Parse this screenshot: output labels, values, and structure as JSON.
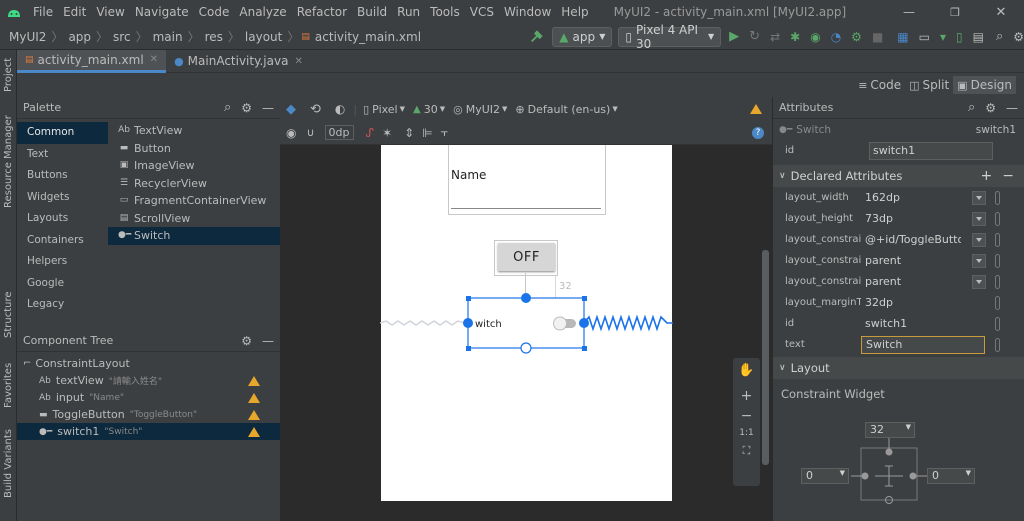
{
  "window": {
    "title": "MyUI2 - activity_main.xml [MyUI2.app]"
  },
  "menu": [
    "File",
    "Edit",
    "View",
    "Navigate",
    "Code",
    "Analyze",
    "Refactor",
    "Build",
    "Run",
    "Tools",
    "VCS",
    "Window",
    "Help"
  ],
  "breadcrumb": [
    "MyUI2",
    "app",
    "src",
    "main",
    "res",
    "layout",
    "activity_main.xml"
  ],
  "toolbar": {
    "run_config": "app",
    "device": "Pixel 4 API 30"
  },
  "side_tools": {
    "project": "Project",
    "resource_manager": "Resource Manager",
    "structure": "Structure",
    "favorites": "Favorites",
    "build_variants": "Build Variants"
  },
  "tabs": [
    {
      "label": "activity_main.xml"
    },
    {
      "label": "MainActivity.java"
    }
  ],
  "view_modes": [
    "Code",
    "Split",
    "Design"
  ],
  "palette": {
    "title": "Palette",
    "categories": [
      "Common",
      "Text",
      "Buttons",
      "Widgets",
      "Layouts",
      "Containers",
      "Helpers",
      "Google",
      "Legacy"
    ],
    "widgets": [
      {
        "icon": "Ab",
        "label": "TextView"
      },
      {
        "icon": "▬",
        "label": "Button"
      },
      {
        "icon": "▣",
        "label": "ImageView"
      },
      {
        "icon": "☰",
        "label": "RecyclerView"
      },
      {
        "icon": "▭",
        "label": "FragmentContainerView"
      },
      {
        "icon": "▤",
        "label": "ScrollView"
      },
      {
        "icon": "●━",
        "label": "Switch"
      }
    ]
  },
  "component_tree": {
    "title": "Component Tree",
    "root": "ConstraintLayout",
    "nodes": [
      {
        "icon": "Ab",
        "name": "textView",
        "desc": "\"請輸入姓名\""
      },
      {
        "icon": "Ab",
        "name": "input",
        "desc": "\"Name\""
      },
      {
        "icon": "▬",
        "name": "ToggleButton",
        "desc": "\"ToggleButton\""
      },
      {
        "icon": "●━",
        "name": "switch1",
        "desc": "\"Switch\""
      }
    ]
  },
  "design_toolbar": {
    "device": "Pixel",
    "api": "30",
    "theme": "MyUI2",
    "locale": "Default (en-us)",
    "margin": "0dp"
  },
  "preview": {
    "input_hint": "Name",
    "toggle_text": "OFF",
    "switch_text": "witch",
    "margin_label": "32"
  },
  "attributes": {
    "title": "Attributes",
    "widget_type": "Switch",
    "widget_id": "switch1",
    "id_label": "id",
    "id_value": "switch1",
    "declared_title": "Declared Attributes",
    "declared": [
      {
        "name": "layout_width",
        "value": "162dp"
      },
      {
        "name": "layout_height",
        "value": "73dp"
      },
      {
        "name": "layout_constraint...",
        "value": "@+id/ToggleButto"
      },
      {
        "name": "layout_constraint...",
        "value": "parent"
      },
      {
        "name": "layout_constraint...",
        "value": "parent"
      },
      {
        "name": "layout_marginTop",
        "value": "32dp"
      },
      {
        "name": "id",
        "value": "switch1"
      },
      {
        "name": "text",
        "value": "Switch"
      }
    ],
    "layout_title": "Layout",
    "constraint_widget": "Constraint Widget",
    "margin_top": "32",
    "margin_left": "0",
    "margin_right": "0"
  },
  "colors": {
    "accent": "#4a88c7",
    "selection": "#0d293e",
    "warning": "#e6a72c",
    "run_green": "#59a869",
    "blueprint": "#1a73e8"
  }
}
